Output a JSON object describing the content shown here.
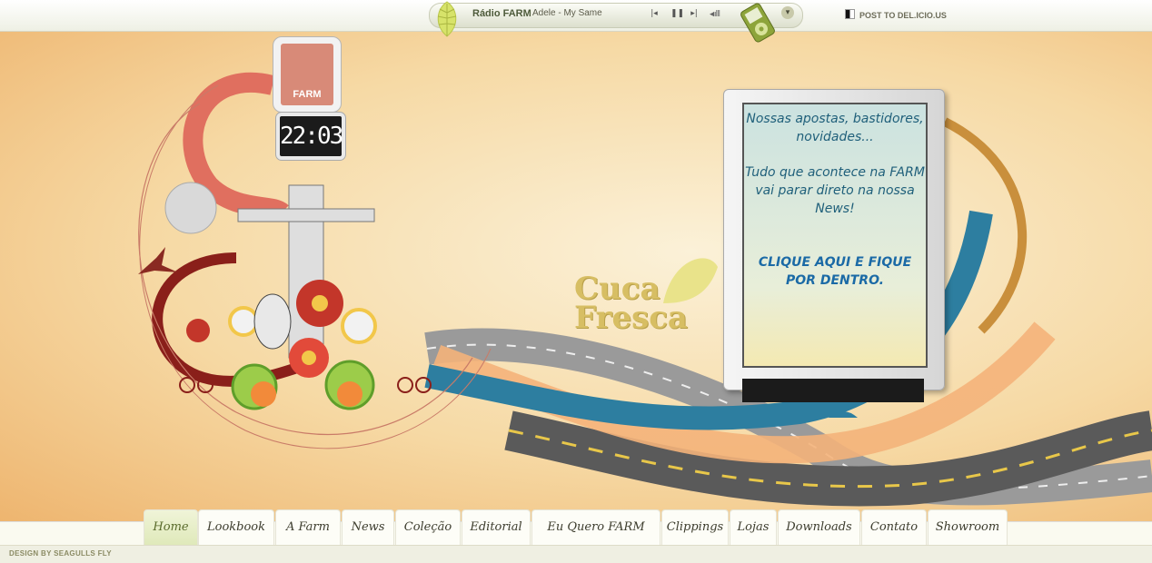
{
  "radio": {
    "label": "Rádio FARM",
    "track": "Adele - My Same",
    "controls": [
      "prev-icon",
      "pause-icon",
      "next-icon",
      "volume-icon"
    ],
    "dropdown_icon": "chevron-down-icon"
  },
  "delicious": {
    "label": "POST TO DEL.ICIO.US"
  },
  "clock": {
    "time": "22:03",
    "sign_text": "FARM"
  },
  "billboard": {
    "text_1": "Nossas apostas, bastidores, novidades...",
    "text_2": "Tudo que acontece na FARM vai parar direto na nossa News!",
    "cta": "CLIQUE AQUI E FIQUE POR DENTRO."
  },
  "art": {
    "logo": "Cuca Fresca"
  },
  "nav": {
    "items": [
      "Home",
      "Lookbook",
      "A Farm",
      "News",
      "Coleção",
      "Editorial",
      "Eu Quero FARM",
      "Clippings",
      "Lojas",
      "Downloads",
      "Contato",
      "Showroom"
    ],
    "active": "Home"
  },
  "footer": {
    "credit": "DESIGN BY SEAGULLS FLY"
  },
  "colors": {
    "accent": "#5a6b2c",
    "billboard_text": "#1f5f7a",
    "swoosh_blue": "#2d7ea0",
    "swoosh_red": "#e06f5f"
  }
}
